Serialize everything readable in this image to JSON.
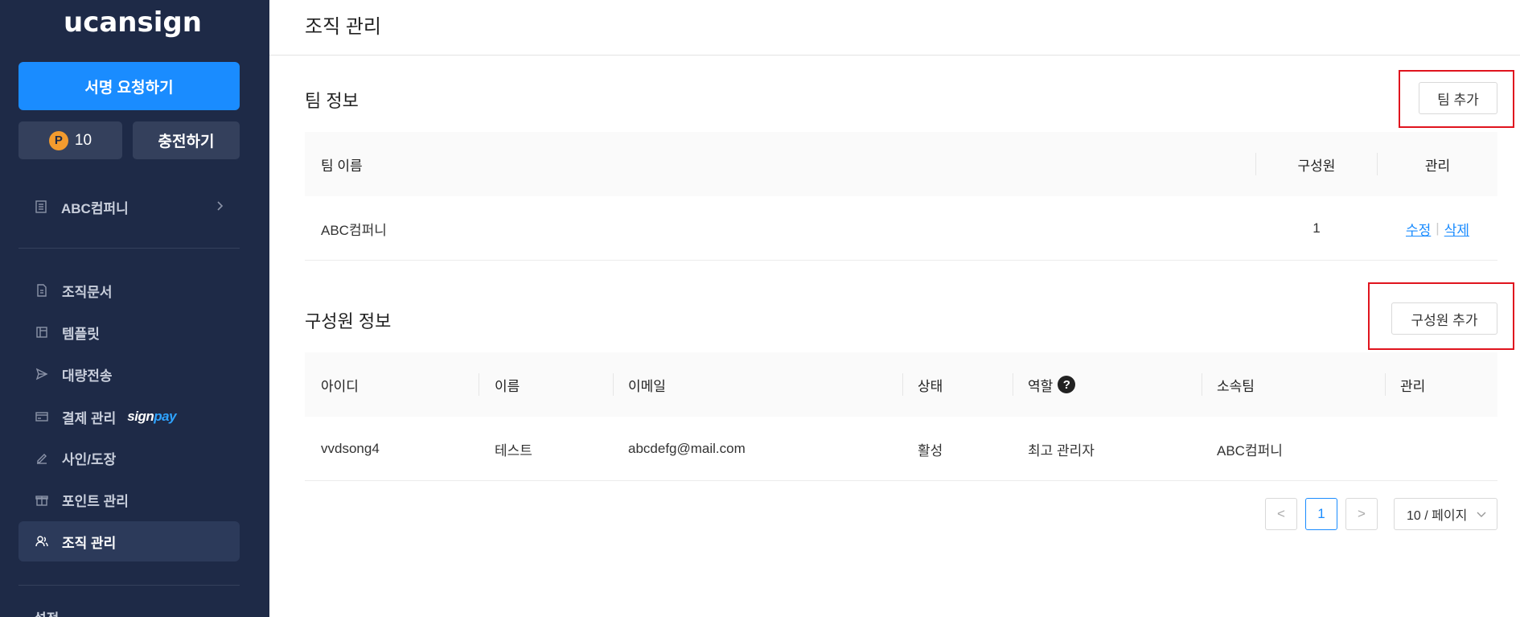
{
  "sidebar": {
    "logo_main": "ucansign",
    "request_button": "서명 요청하기",
    "points_badge": "P",
    "points_value": "10",
    "charge_button": "충전하기",
    "company": "ABC컴퍼니",
    "items": [
      {
        "label": "조직문서",
        "icon": "document-icon"
      },
      {
        "label": "템플릿",
        "icon": "template-icon"
      },
      {
        "label": "대량전송",
        "icon": "send-icon"
      },
      {
        "label": "결제 관리",
        "icon": "card-icon",
        "badge_a": "sign",
        "badge_b": "pay"
      },
      {
        "label": "사인/도장",
        "icon": "pen-icon"
      },
      {
        "label": "포인트 관리",
        "icon": "gift-icon"
      },
      {
        "label": "조직 관리",
        "icon": "users-icon",
        "active": true
      }
    ],
    "settings": "설정"
  },
  "main": {
    "title": "조직 관리",
    "team_section": {
      "title": "팀 정보",
      "add_button": "팀 추가",
      "columns": [
        "팀 이름",
        "구성원",
        "관리"
      ],
      "rows": [
        {
          "name": "ABC컴퍼니",
          "members": "1",
          "edit": "수정",
          "delete": "삭제"
        }
      ]
    },
    "member_section": {
      "title": "구성원 정보",
      "add_button": "구성원 추가",
      "columns": [
        "아이디",
        "이름",
        "이메일",
        "상태",
        "역할",
        "소속팀",
        "관리"
      ],
      "help_icon": "?",
      "rows": [
        {
          "id": "vvdsong4",
          "name": "테스트",
          "email": "abcdefg@mail.com",
          "status": "활성",
          "role": "최고 관리자",
          "team": "ABC컴퍼니",
          "manage": ""
        }
      ]
    },
    "pagination": {
      "prev": "<",
      "current": "1",
      "next": ">",
      "page_size": "10 / 페이지"
    }
  },
  "colors": {
    "sidebar_bg": "#1e2a47",
    "accent": "#1a8cff",
    "highlight_box": "#e0141e"
  }
}
